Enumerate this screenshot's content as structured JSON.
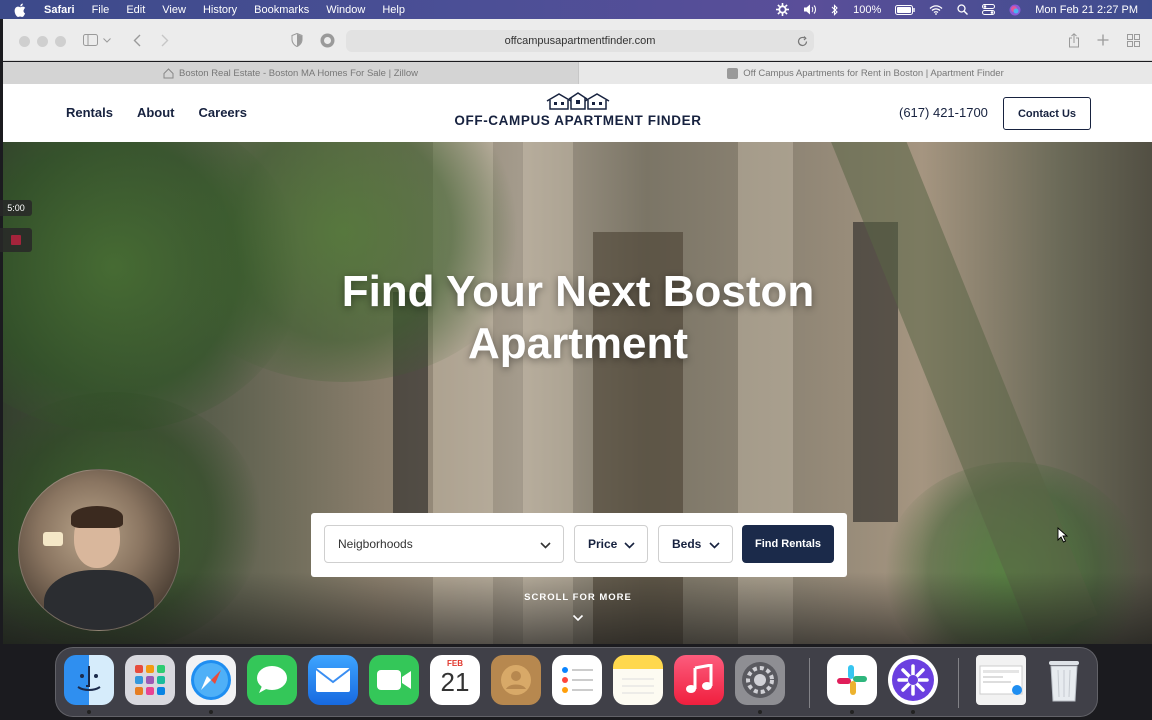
{
  "menubar": {
    "app": "Safari",
    "items": [
      "File",
      "Edit",
      "View",
      "History",
      "Bookmarks",
      "Window",
      "Help"
    ],
    "battery": "100%",
    "datetime": "Mon Feb 21  2:27 PM"
  },
  "browser": {
    "url": "offcampusapartmentfinder.com",
    "tabs": [
      {
        "title": "Boston Real Estate - Boston MA Homes For Sale | Zillow"
      },
      {
        "title": "Off Campus Apartments for Rent in Boston | Apartment Finder"
      }
    ]
  },
  "site": {
    "nav": [
      "Rentals",
      "About",
      "Careers"
    ],
    "logo_text": "OFF-CAMPUS APARTMENT FINDER",
    "phone": "(617) 421-1700",
    "contact_label": "Contact Us",
    "hero_title": "Find Your Next Boston Apartment",
    "search": {
      "neighborhoods": "Neigborhoods",
      "price": "Price",
      "beds": "Beds",
      "submit": "Find Rentals"
    },
    "scroll_hint": "SCROLL FOR MORE"
  },
  "recording": {
    "timer": "5:00"
  },
  "dock": {
    "calendar_month": "FEB",
    "calendar_day": "21",
    "apps": [
      "finder",
      "launchpad",
      "safari",
      "messages",
      "mail",
      "facetime",
      "calendar",
      "contacts",
      "reminders",
      "notes",
      "music",
      "system-preferences",
      "slack",
      "ai-app",
      "preview",
      "trash"
    ]
  },
  "colors": {
    "brand_navy": "#1b2a4a",
    "recording_red": "#a4243b"
  }
}
